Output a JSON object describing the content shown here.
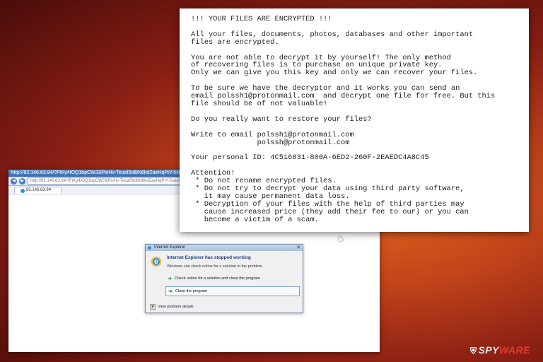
{
  "browser": {
    "title": "http://82.146.63.94/?FtKy4IOQ1bpCWJ3iPxiHv-Teuaf3IdbN6kdZaeHqPtY-5suaf3IdbN...",
    "address": "http://82.146.63.94/?FtKy4IOQ1bpCWJ3iPxiHv-Teuaf3IdbN6kdZaeHqPtY-5suaf3IdbN",
    "tab_label": "82.146.63.94"
  },
  "dialog": {
    "title": "Internet Explorer",
    "heading": "Internet Explorer has stopped working",
    "subtext": "Windows can check online for a solution to the problem.",
    "option_check": "Check online for a solution and close the program",
    "option_close": "Close the program",
    "details_label": "View problem details"
  },
  "note": {
    "text": "!!! YOUR FILES ARE ENCRYPTED !!!\n\nAll your files, documents, photos, databases and other important\nfiles are encrypted.\n\nYou are not able to decrypt it by yourself! The only method\nof recovering files is to purchase an unique private key.\nOnly we can give you this key and only we can recover your files.\n\nTo be sure we have the decryptor and it works you can send an\nemail polssh1@protonmail.com  and decrypt one file for free. But this\nfile should be of not valuable!\n\nDo you really want to restore your files?\n\nWrite to email polssh1@protonmail.com\n               polssh@protonmail.com\n\nYour personal ID: 4C516831-800A-6ED2-260F-2EAEDC4A8C45\n\nAttention!\n * Do not rename encrypted files.\n * Do not try to decrypt your data using third party software,\n   it may cause permanent data loss.\n * Decryption of your files with the help of third parties may\n   cause increased price (they add their fee to our) or you can\n   become a victim of a scam."
  },
  "watermark": {
    "part1": "SPY",
    "part2": "WARE"
  }
}
